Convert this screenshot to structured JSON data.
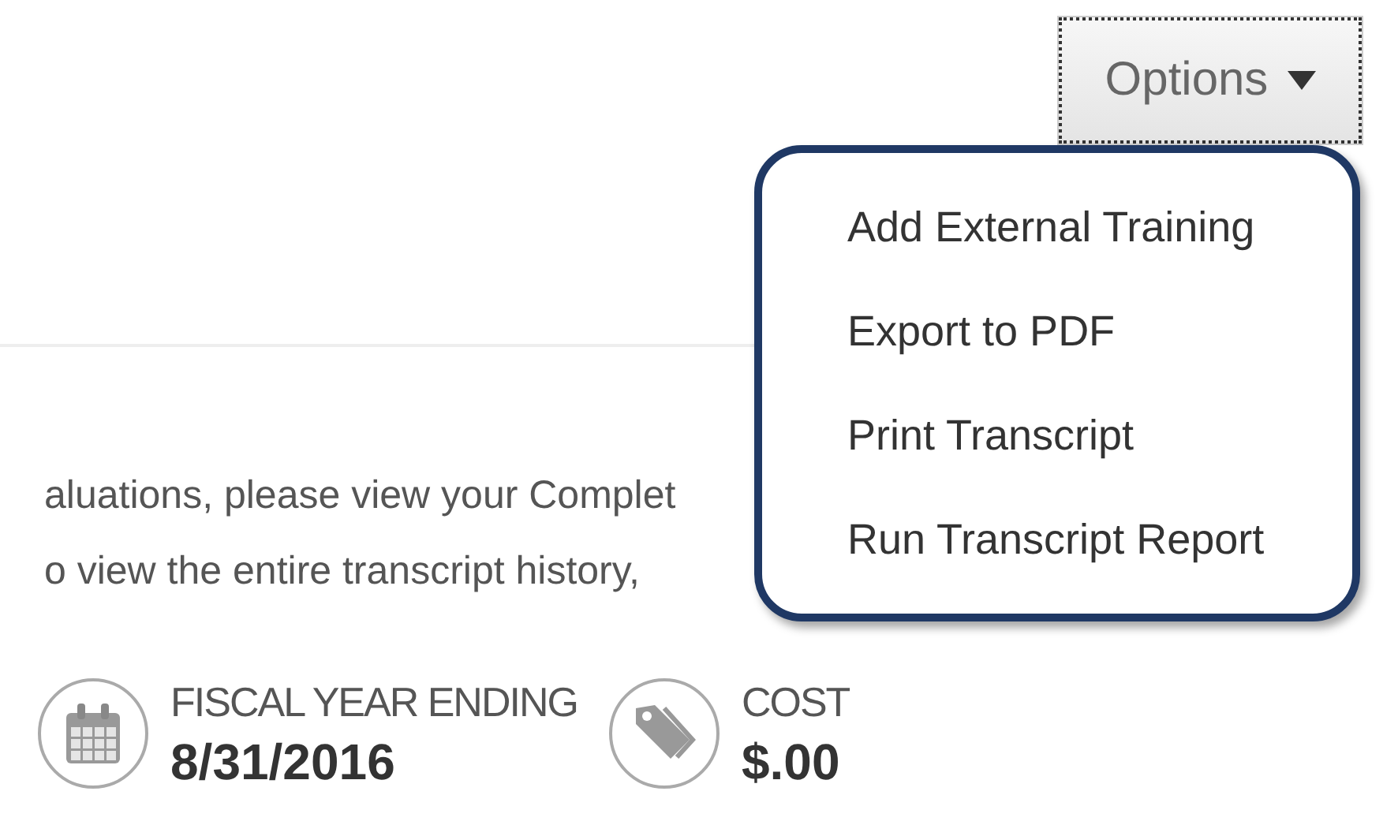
{
  "options_button": {
    "label": "Options",
    "expanded": true
  },
  "options_menu": [
    {
      "label": "Add External Training"
    },
    {
      "label": "Export to PDF"
    },
    {
      "label": "Print Transcript"
    },
    {
      "label": "Run Transcript Report"
    }
  ],
  "intro_lines": [
    "aluations, please view your Complet",
    "o view the entire transcript history,"
  ],
  "stats": [
    {
      "kind": "calendar",
      "label": "FISCAL YEAR ENDING",
      "value": "8/31/2016"
    },
    {
      "kind": "tag",
      "label": "COST",
      "value": "$.00"
    }
  ]
}
